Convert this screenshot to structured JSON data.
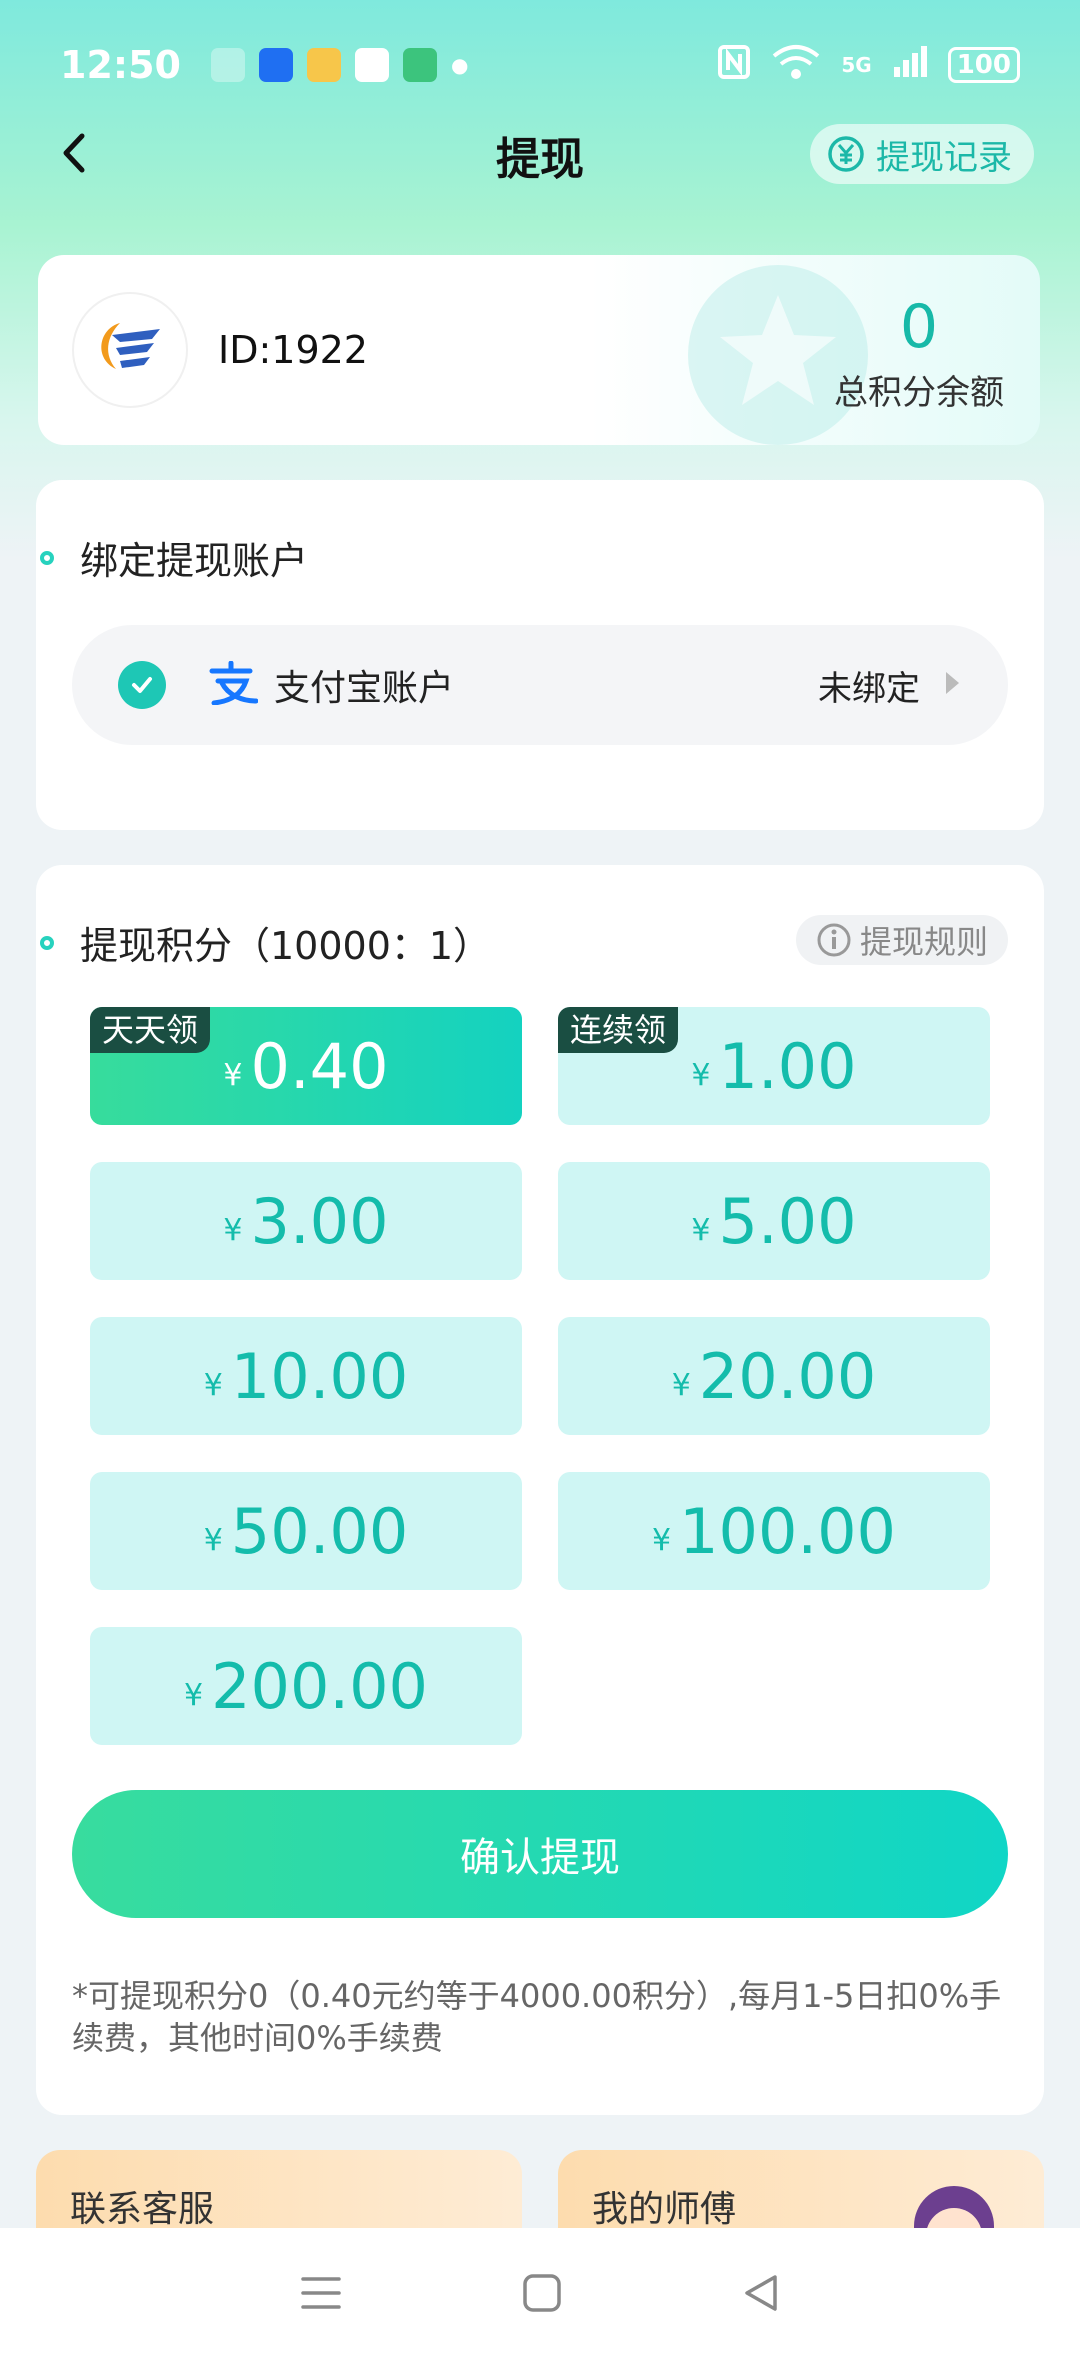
{
  "status_bar": {
    "time": "12:50",
    "network": "5G",
    "battery": "100"
  },
  "header": {
    "title": "提现",
    "record_label": "提现记录"
  },
  "user": {
    "id_text": "ID:1922",
    "balance_value": "0",
    "balance_label": "总积分余额"
  },
  "bind_section": {
    "title": "绑定提现账户",
    "account_label": "支付宝账户",
    "account_status": "未绑定"
  },
  "withdraw_section": {
    "title": "提现积分（10000：1）",
    "rules_label": "提现规则",
    "currency": "¥",
    "options": [
      {
        "value": "0.40",
        "tag": "天天领"
      },
      {
        "value": "1.00",
        "tag": "连续领"
      },
      {
        "value": "3.00"
      },
      {
        "value": "5.00"
      },
      {
        "value": "10.00"
      },
      {
        "value": "20.00"
      },
      {
        "value": "50.00"
      },
      {
        "value": "100.00"
      },
      {
        "value": "200.00"
      }
    ],
    "confirm_label": "确认提现",
    "note": "*可提现积分0（0.40元约等于4000.00积分）,每月1-5日扣0%手续费，其他时间0%手续费"
  },
  "bottom_cards": {
    "service_label": "联系客服",
    "teacher_label": "我的师傅"
  },
  "colors": {
    "accent": "#17b9a8",
    "option_bg": "#cff6f4",
    "tag_bg": "#1a4e42"
  }
}
